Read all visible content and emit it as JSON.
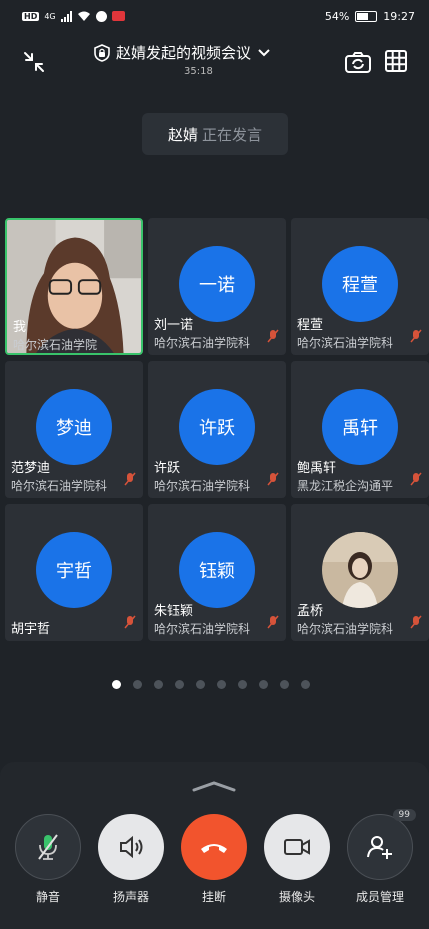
{
  "status_bar": {
    "hd": "HD",
    "network": "4G",
    "battery": "54%",
    "time": "19:27"
  },
  "header": {
    "title": "赵婧发起的视频会议",
    "timer": "35:18"
  },
  "speaker": {
    "name": "赵婧",
    "status": "正在发言"
  },
  "participants": [
    {
      "avatar_text": "",
      "name": "我",
      "org": "哈尔滨石油学院",
      "is_self": true
    },
    {
      "avatar_text": "一诺",
      "name": "刘一诺",
      "org": "哈尔滨石油学院科"
    },
    {
      "avatar_text": "程萱",
      "name": "程萱",
      "org": "哈尔滨石油学院科"
    },
    {
      "avatar_text": "梦迪",
      "name": "范梦迪",
      "org": "哈尔滨石油学院科"
    },
    {
      "avatar_text": "许跃",
      "name": "许跃",
      "org": "哈尔滨石油学院科"
    },
    {
      "avatar_text": "禹轩",
      "name": "鲍禹轩",
      "org": "黑龙江税企沟通平"
    },
    {
      "avatar_text": "宇哲",
      "name": "胡宇哲",
      "org": ""
    },
    {
      "avatar_text": "钰颖",
      "name": "朱钰颖",
      "org": "哈尔滨石油学院科"
    },
    {
      "avatar_text": "",
      "name": "孟桥",
      "org": "哈尔滨石油学院科",
      "photo": true
    }
  ],
  "pager": {
    "pages": 10,
    "current": 1
  },
  "controls": {
    "mute": "静音",
    "speaker": "扬声器",
    "hangup": "挂断",
    "camera": "摄像头",
    "members": "成员管理",
    "members_badge": "99"
  },
  "colors": {
    "background": "#1f2328",
    "avatar_blue": "#1a73e8",
    "hangup_red": "#f2542d",
    "active_green": "#39c36b"
  }
}
